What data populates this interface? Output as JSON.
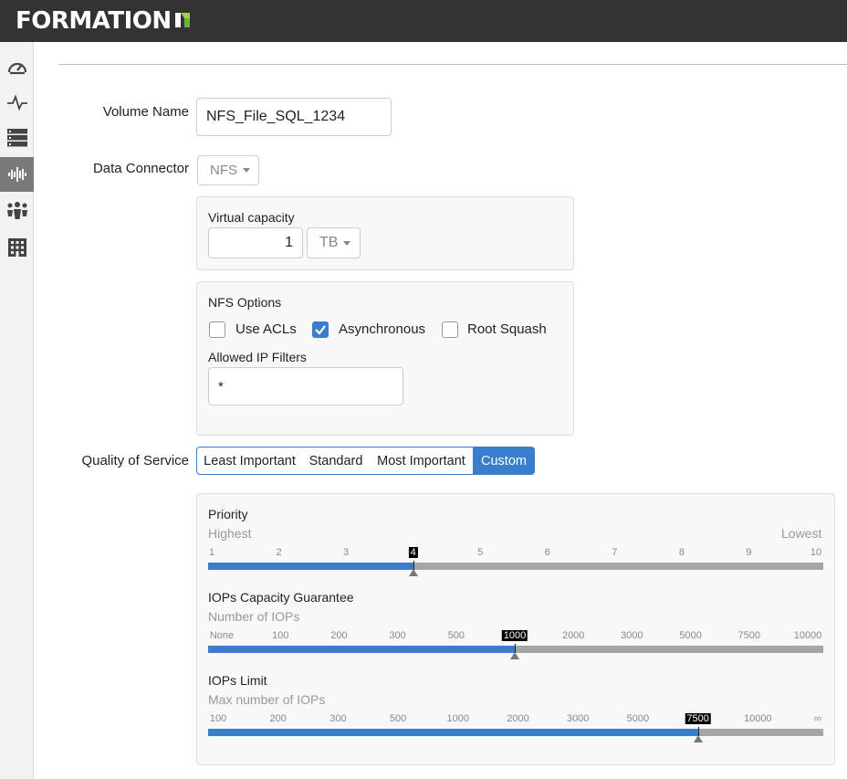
{
  "app": {
    "brand": "FORMATION"
  },
  "nav": [
    "dashboard",
    "activity",
    "storage",
    "volumes",
    "users",
    "tenants"
  ],
  "form": {
    "volume_name_label": "Volume Name",
    "volume_name_value": "NFS_File_SQL_1234",
    "data_connector_label": "Data Connector",
    "data_connector_value": "NFS",
    "capacity": {
      "label": "Virtual capacity",
      "value": "1",
      "unit": "TB"
    },
    "nfs": {
      "label": "NFS Options",
      "options": [
        {
          "label": "Use ACLs",
          "checked": false
        },
        {
          "label": "Asynchronous",
          "checked": true
        },
        {
          "label": "Root Squash",
          "checked": false
        }
      ],
      "ip_label": "Allowed IP Filters",
      "ip_value": "*"
    },
    "qos": {
      "label": "Quality of Service",
      "options": [
        "Least Important",
        "Standard",
        "Most Important",
        "Custom"
      ],
      "selected": "Custom"
    },
    "sliders": [
      {
        "title": "Priority",
        "subtitle": "Highest",
        "subtitle_right": "Lowest",
        "ticks": [
          "1",
          "2",
          "3",
          "4",
          "5",
          "6",
          "7",
          "8",
          "9",
          "10"
        ],
        "selected_index": 3
      },
      {
        "title": "IOPs Capacity Guarantee",
        "subtitle": "Number of IOPs",
        "subtitle_right": "",
        "ticks": [
          "None",
          "100",
          "200",
          "300",
          "500",
          "1000",
          "2000",
          "3000",
          "5000",
          "7500",
          "10000"
        ],
        "selected_index": 5
      },
      {
        "title": "IOPs Limit",
        "subtitle": "Max number of IOPs",
        "subtitle_right": "",
        "ticks": [
          "100",
          "200",
          "300",
          "500",
          "1000",
          "2000",
          "3000",
          "5000",
          "7500",
          "10000",
          "∞"
        ],
        "selected_index": 8
      }
    ]
  },
  "colors": {
    "accent": "#3a7ecb",
    "topbar": "#333333",
    "track": "#a5a5a5"
  }
}
